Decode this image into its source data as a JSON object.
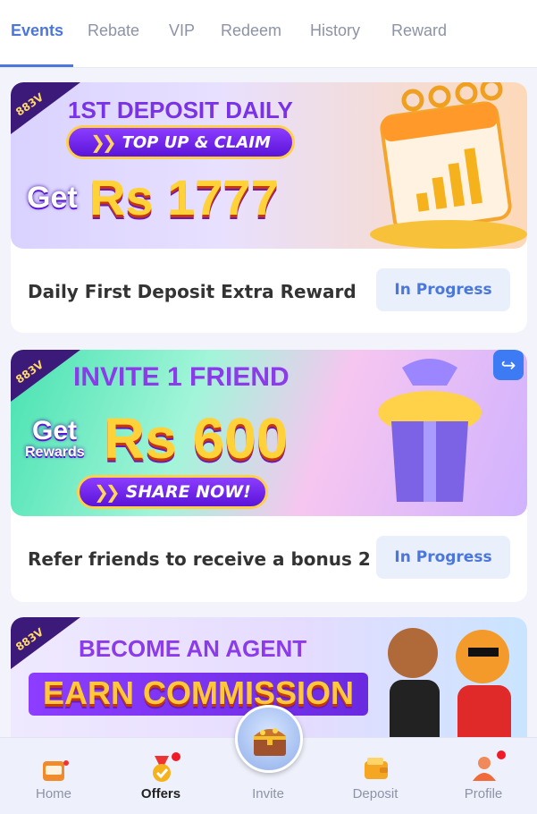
{
  "tabs": [
    {
      "label": "Events",
      "active": true
    },
    {
      "label": "Rebate"
    },
    {
      "label": "VIP"
    },
    {
      "label": "Redeem"
    },
    {
      "label": "History"
    },
    {
      "label": "Reward"
    }
  ],
  "cards": [
    {
      "banner": {
        "brand": "883V",
        "headline": "1ST DEPOSIT DAILY",
        "button": "TOP UP & CLAIM",
        "get": "Get",
        "amount": "Rs 1777"
      },
      "title": "Daily First Deposit Extra Reward",
      "status": "In Progress"
    },
    {
      "banner": {
        "brand": "883V",
        "headline": "INVITE 1 FRIEND",
        "get": "Get",
        "get_sub": "Rewards",
        "amount": "Rs 600",
        "button": "SHARE NOW!"
      },
      "title": "Refer friends to receive a bonus 2",
      "status": "In Progress"
    },
    {
      "banner": {
        "brand": "883V",
        "headline": "BECOME AN AGENT",
        "subheadline": "EARN COMMISSION"
      }
    }
  ],
  "bottom_nav": [
    {
      "label": "Home",
      "icon": "slot-machine-icon"
    },
    {
      "label": "Offers",
      "icon": "medal-icon",
      "active": true,
      "badge": true
    },
    {
      "label": "Invite",
      "icon": "treasure-chest-icon"
    },
    {
      "label": "Deposit",
      "icon": "wallet-icon"
    },
    {
      "label": "Profile",
      "icon": "user-icon",
      "badge": true
    }
  ],
  "colors": {
    "accent": "#4b77dc",
    "badge": "#f01a28",
    "progress_bg": "#e9effb"
  }
}
